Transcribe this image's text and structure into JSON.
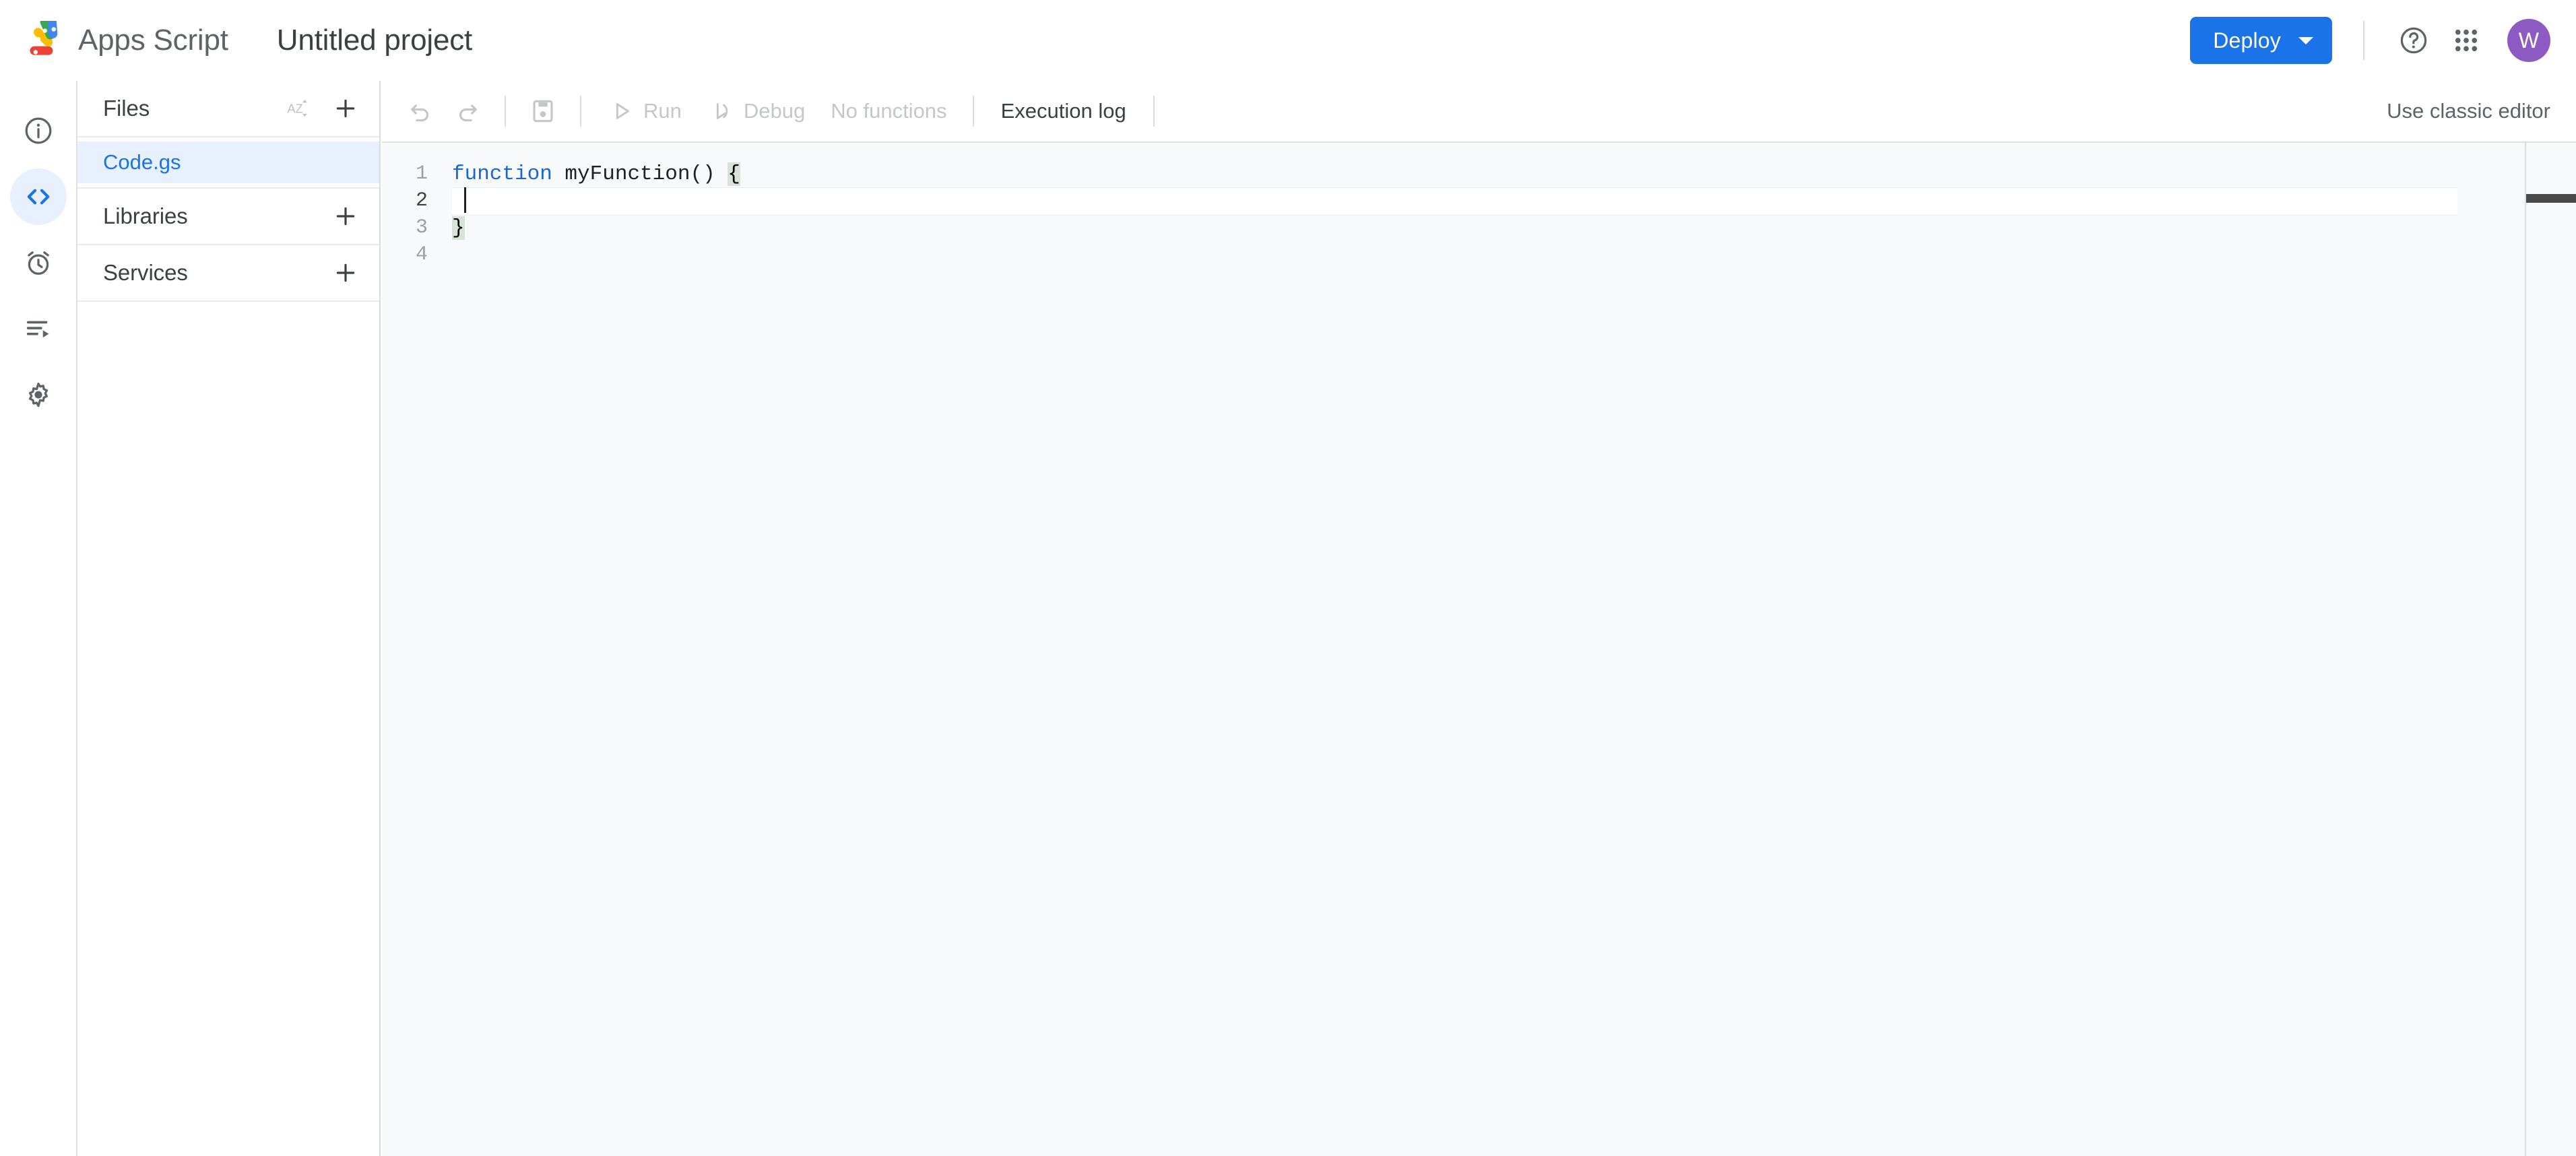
{
  "header": {
    "brand_name": "Apps Script",
    "project_title": "Untitled project",
    "logo_icon": "apps-script-logo",
    "deploy_label": "Deploy",
    "deploy_caret_icon": "chevron-down-icon",
    "help_icon": "help-circle-icon",
    "apps_icon": "apps-grid-icon",
    "avatar_initial": "W",
    "colors": {
      "deploy_bg": "#1a73e8",
      "avatar_bg": "#8e5bc4",
      "accent": "#1a73e8"
    }
  },
  "rail": {
    "items": [
      {
        "name": "overview",
        "icon": "info-circle-icon",
        "active": false
      },
      {
        "name": "editor",
        "icon": "code-brackets-icon",
        "active": true
      },
      {
        "name": "triggers",
        "icon": "alarm-clock-icon",
        "active": false
      },
      {
        "name": "executions",
        "icon": "executions-list-icon",
        "active": false
      },
      {
        "name": "project-settings",
        "icon": "gear-icon",
        "active": false
      }
    ]
  },
  "files_panel": {
    "sections": [
      {
        "title": "Files",
        "sort_icon": "sort-az-icon",
        "add_icon": "plus-icon",
        "has_sort": true
      },
      {
        "title": "Libraries",
        "add_icon": "plus-icon",
        "has_sort": false
      },
      {
        "title": "Services",
        "add_icon": "plus-icon",
        "has_sort": false
      }
    ],
    "files": [
      {
        "name": "Code.gs",
        "selected": true
      }
    ]
  },
  "toolbar": {
    "undo_icon": "undo-icon",
    "redo_icon": "redo-icon",
    "save_icon": "save-floppy-icon",
    "run_label": "Run",
    "run_icon": "play-triangle-icon",
    "debug_label": "Debug",
    "debug_icon": "debug-icon",
    "function_select_label": "No functions",
    "execution_log_label": "Execution log",
    "classic_editor_label": "Use classic editor"
  },
  "editor": {
    "language": "javascript",
    "lines": [
      {
        "number": "1",
        "segments": [
          {
            "text": "function",
            "style": "kw"
          },
          {
            "text": " myFunction() ",
            "style": "ident"
          },
          {
            "text": "{",
            "style": "brace-match"
          }
        ],
        "active": false
      },
      {
        "number": "2",
        "segments": [
          {
            "text": "  ",
            "style": "ident"
          }
        ],
        "active": true
      },
      {
        "number": "3",
        "segments": [
          {
            "text": "}",
            "style": "brace-match"
          }
        ],
        "active": false
      },
      {
        "number": "4",
        "segments": [],
        "active": false
      }
    ],
    "cursor_line": "2",
    "cursor_column": "3"
  }
}
